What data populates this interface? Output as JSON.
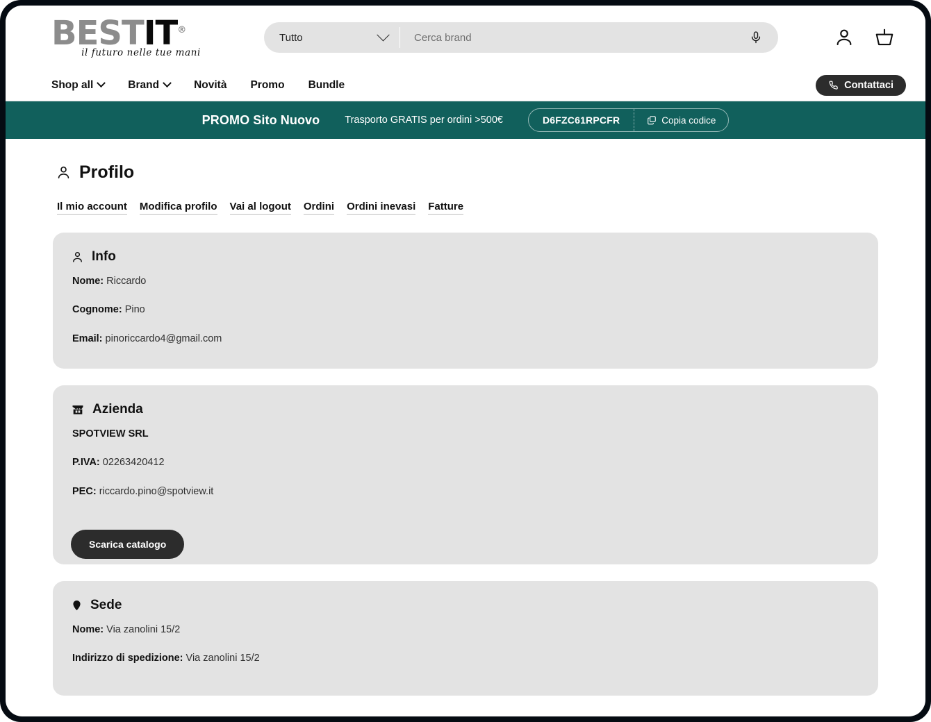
{
  "brand": {
    "name_primary": "BEST",
    "name_secondary": "IT",
    "registered": "®",
    "tagline": "il futuro nelle tue mani"
  },
  "search": {
    "category_label": "Tutto",
    "placeholder": "Cerca brand",
    "value": "",
    "mic_icon": "microphone-icon",
    "chevron_icon": "chevron-down-icon"
  },
  "header_icons": {
    "account": "user-icon",
    "cart": "basket-icon"
  },
  "nav": {
    "items": [
      {
        "label": "Shop all",
        "has_chevron": true
      },
      {
        "label": "Brand",
        "has_chevron": true
      },
      {
        "label": "Novità",
        "has_chevron": false
      },
      {
        "label": "Promo",
        "has_chevron": false
      },
      {
        "label": "Bundle",
        "has_chevron": false
      }
    ],
    "contact_label": "Contattaci",
    "contact_icon": "phone-icon"
  },
  "promo": {
    "title": "PROMO Sito Nuovo",
    "subtitle": "Trasporto GRATIS per ordini >500€",
    "code": "D6FZC61RPCFR",
    "copy_label": "Copia codice",
    "copy_icon": "copy-icon",
    "background_color": "#11605c"
  },
  "page": {
    "title": "Profilo",
    "title_icon": "user-icon"
  },
  "tabs": [
    {
      "label": "Il mio account"
    },
    {
      "label": "Modifica profilo"
    },
    {
      "label": "Vai al logout"
    },
    {
      "label": "Ordini"
    },
    {
      "label": "Ordini inevasi"
    },
    {
      "label": "Fatture"
    }
  ],
  "cards": {
    "info": {
      "title": "Info",
      "icon": "user-icon",
      "nome_label": "Nome:",
      "nome_value": "Riccardo",
      "cognome_label": "Cognome:",
      "cognome_value": "Pino",
      "email_label": "Email:",
      "email_value": "pinoriccardo4@gmail.com"
    },
    "azienda": {
      "title": "Azienda",
      "icon": "store-icon",
      "company_name": "SPOTVIEW SRL",
      "piva_label": "P.IVA:",
      "piva_value": "02263420412",
      "pec_label": "PEC:",
      "pec_value": "riccardo.pino@spotview.it",
      "download_label": "Scarica catalogo"
    },
    "sede": {
      "title": "Sede",
      "icon": "map-pin-icon",
      "nome_label": "Nome:",
      "nome_value": "Via zanolini 15/2",
      "indirizzo_label": "Indirizzo di spedizione:",
      "indirizzo_value": "Via zanolini 15/2"
    }
  },
  "colors": {
    "card_background": "#e3e3e3",
    "dark_button": "#2c2c2c",
    "promo_teal": "#11605c"
  }
}
